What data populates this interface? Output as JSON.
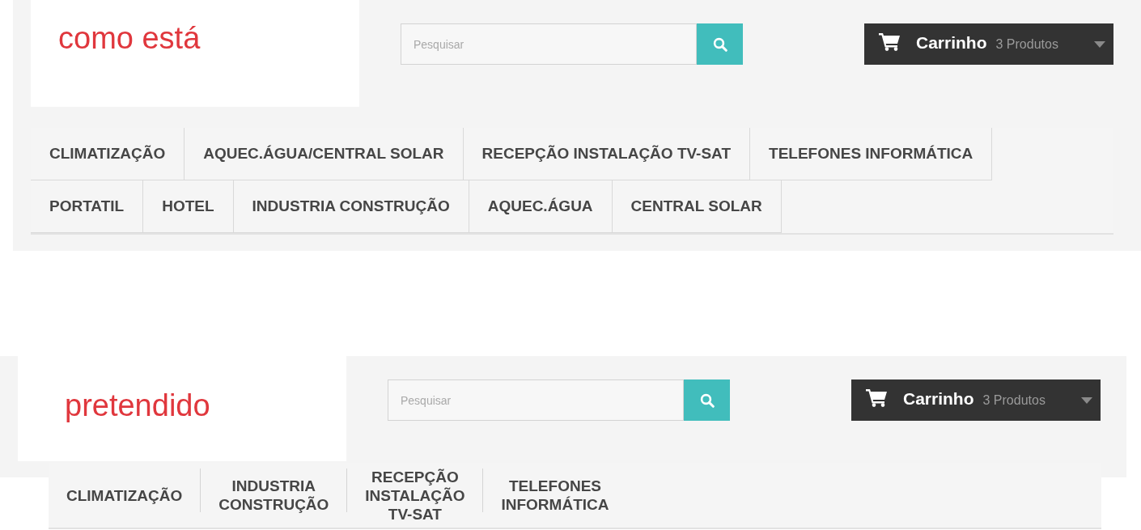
{
  "panels": [
    {
      "kind": "tabs",
      "caption": "como está",
      "search": {
        "placeholder": "Pesquisar"
      },
      "cart": {
        "title": "Carrinho",
        "count": "3 Produtos"
      },
      "menu": [
        "CLIMATIZAÇÃO",
        "AQUEC.ÁGUA/CENTRAL SOLAR",
        "RECEPÇÃO INSTALAÇÃO TV-SAT",
        "TELEFONES INFORMÁTICA",
        "PORTATIL",
        "HOTEL",
        "INDUSTRIA CONSTRUÇÃO",
        "AQUEC.ÁGUA",
        "CENTRAL SOLAR"
      ]
    },
    {
      "kind": "stacked",
      "caption": "pretendido",
      "search": {
        "placeholder": "Pesquisar"
      },
      "cart": {
        "title": "Carrinho",
        "count": "3 Produtos"
      },
      "menu": [
        "CLIMATIZAÇÃO",
        "INDUSTRIA CONSTRUÇÃO",
        "RECEPÇÃO INSTALAÇÃO TV-SAT",
        "TELEFONES INFORMÁTICA"
      ]
    }
  ]
}
